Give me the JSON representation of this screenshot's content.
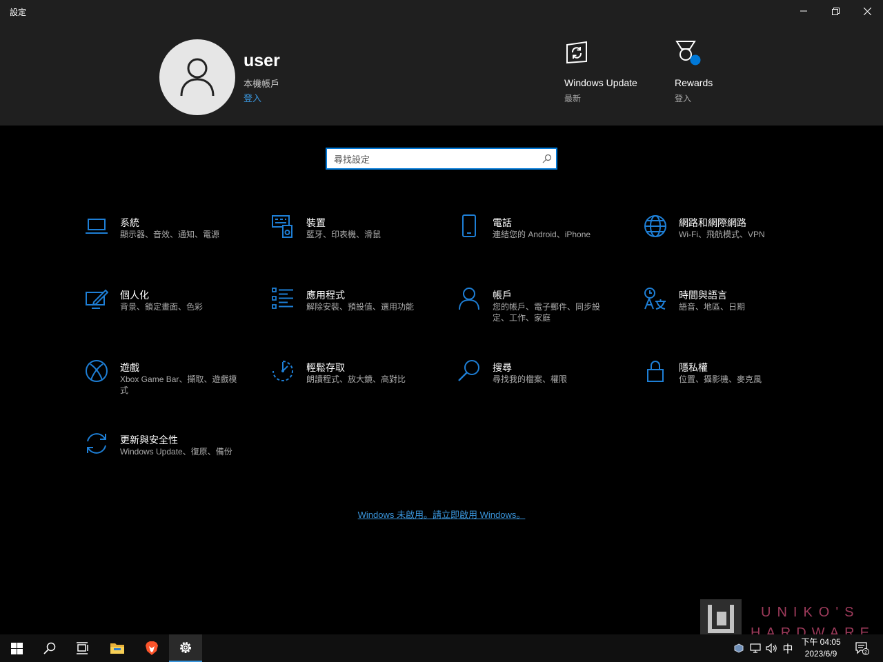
{
  "window": {
    "title": "設定"
  },
  "account": {
    "name": "user",
    "type": "本機帳戶",
    "signin": "登入"
  },
  "quick": [
    {
      "label": "Windows Update",
      "sub": "最新"
    },
    {
      "label": "Rewards",
      "sub": "登入"
    }
  ],
  "search": {
    "placeholder": "尋找設定"
  },
  "categories": [
    {
      "name": "系統",
      "desc": "顯示器、音效、通知、電源",
      "icon": "laptop-icon"
    },
    {
      "name": "裝置",
      "desc": "藍牙、印表機、滑鼠",
      "icon": "devices-icon"
    },
    {
      "name": "電話",
      "desc": "連結您的 Android、iPhone",
      "icon": "phone-icon"
    },
    {
      "name": "網路和網際網路",
      "desc": "Wi-Fi、飛航模式、VPN",
      "icon": "globe-icon"
    },
    {
      "name": "個人化",
      "desc": "背景、鎖定畫面、色彩",
      "icon": "personalization-icon"
    },
    {
      "name": "應用程式",
      "desc": "解除安裝、預設值、選用功能",
      "icon": "apps-list-icon"
    },
    {
      "name": "帳戶",
      "desc": "您的帳戶、電子郵件、同步設定、工作、家庭",
      "icon": "person-icon"
    },
    {
      "name": "時間與語言",
      "desc": "語音、地區、日期",
      "icon": "time-language-icon"
    },
    {
      "name": "遊戲",
      "desc": "Xbox Game Bar、擷取、遊戲模式",
      "icon": "xbox-icon"
    },
    {
      "name": "輕鬆存取",
      "desc": "朗讀程式、放大鏡、高對比",
      "icon": "ease-of-access-icon"
    },
    {
      "name": "搜尋",
      "desc": "尋找我的檔案、權限",
      "icon": "search-icon"
    },
    {
      "name": "隱私權",
      "desc": "位置、攝影機、麥克風",
      "icon": "lock-icon"
    },
    {
      "name": "更新與安全性",
      "desc": "Windows Update、復原、備份",
      "icon": "sync-icon"
    }
  ],
  "activation": {
    "text": "Windows 未啟用。請立即啟用 Windows。"
  },
  "watermark": {
    "line1": "UNIKO'S",
    "line2": "HARDWARE"
  },
  "taskbar": {
    "ime": "中",
    "time": "下午 04:05",
    "date": "2023/6/9",
    "notifications": "2"
  },
  "colors": {
    "accent": "#3a96dd",
    "header_bg": "#1f1f1f",
    "background": "#000000"
  }
}
